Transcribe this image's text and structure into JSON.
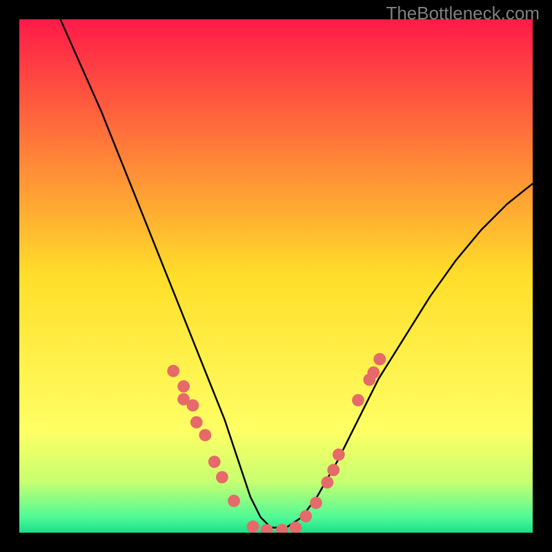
{
  "watermark": "TheBottleneck.com",
  "chart_data": {
    "type": "line",
    "title": "",
    "xlabel": "",
    "ylabel": "",
    "xlim": [
      0,
      1
    ],
    "ylim": [
      0,
      1
    ],
    "background_gradient": {
      "stops": [
        {
          "offset": 0.0,
          "color": "#ff1a48"
        },
        {
          "offset": 0.5,
          "color": "#ffde2a"
        },
        {
          "offset": 0.8,
          "color": "#ffff64"
        },
        {
          "offset": 0.9,
          "color": "#c8ff70"
        },
        {
          "offset": 0.97,
          "color": "#50fa96"
        },
        {
          "offset": 1.0,
          "color": "#18e088"
        }
      ]
    },
    "series": [
      {
        "name": "bottleneck-curve",
        "color": "#000000",
        "x": [
          0.08,
          0.12,
          0.16,
          0.2,
          0.24,
          0.28,
          0.32,
          0.36,
          0.4,
          0.43,
          0.45,
          0.47,
          0.49,
          0.52,
          0.55,
          0.58,
          0.62,
          0.66,
          0.7,
          0.75,
          0.8,
          0.85,
          0.9,
          0.95,
          1.0
        ],
        "y": [
          1.0,
          0.91,
          0.82,
          0.72,
          0.62,
          0.52,
          0.42,
          0.32,
          0.22,
          0.13,
          0.07,
          0.03,
          0.01,
          0.01,
          0.03,
          0.07,
          0.14,
          0.22,
          0.3,
          0.38,
          0.46,
          0.53,
          0.59,
          0.64,
          0.68
        ]
      }
    ],
    "scatter": {
      "name": "sample-points",
      "color": "#e66a6a",
      "radius_frac": 0.012,
      "points": [
        {
          "x": 0.3,
          "y": 0.315
        },
        {
          "x": 0.32,
          "y": 0.285
        },
        {
          "x": 0.32,
          "y": 0.26
        },
        {
          "x": 0.338,
          "y": 0.248
        },
        {
          "x": 0.345,
          "y": 0.215
        },
        {
          "x": 0.362,
          "y": 0.19
        },
        {
          "x": 0.38,
          "y": 0.138
        },
        {
          "x": 0.395,
          "y": 0.108
        },
        {
          "x": 0.418,
          "y": 0.062
        },
        {
          "x": 0.455,
          "y": 0.012
        },
        {
          "x": 0.482,
          "y": 0.005
        },
        {
          "x": 0.512,
          "y": 0.005
        },
        {
          "x": 0.538,
          "y": 0.01
        },
        {
          "x": 0.558,
          "y": 0.032
        },
        {
          "x": 0.578,
          "y": 0.058
        },
        {
          "x": 0.6,
          "y": 0.098
        },
        {
          "x": 0.612,
          "y": 0.122
        },
        {
          "x": 0.622,
          "y": 0.152
        },
        {
          "x": 0.66,
          "y": 0.258
        },
        {
          "x": 0.682,
          "y": 0.298
        },
        {
          "x": 0.69,
          "y": 0.312
        },
        {
          "x": 0.702,
          "y": 0.338
        }
      ]
    }
  }
}
